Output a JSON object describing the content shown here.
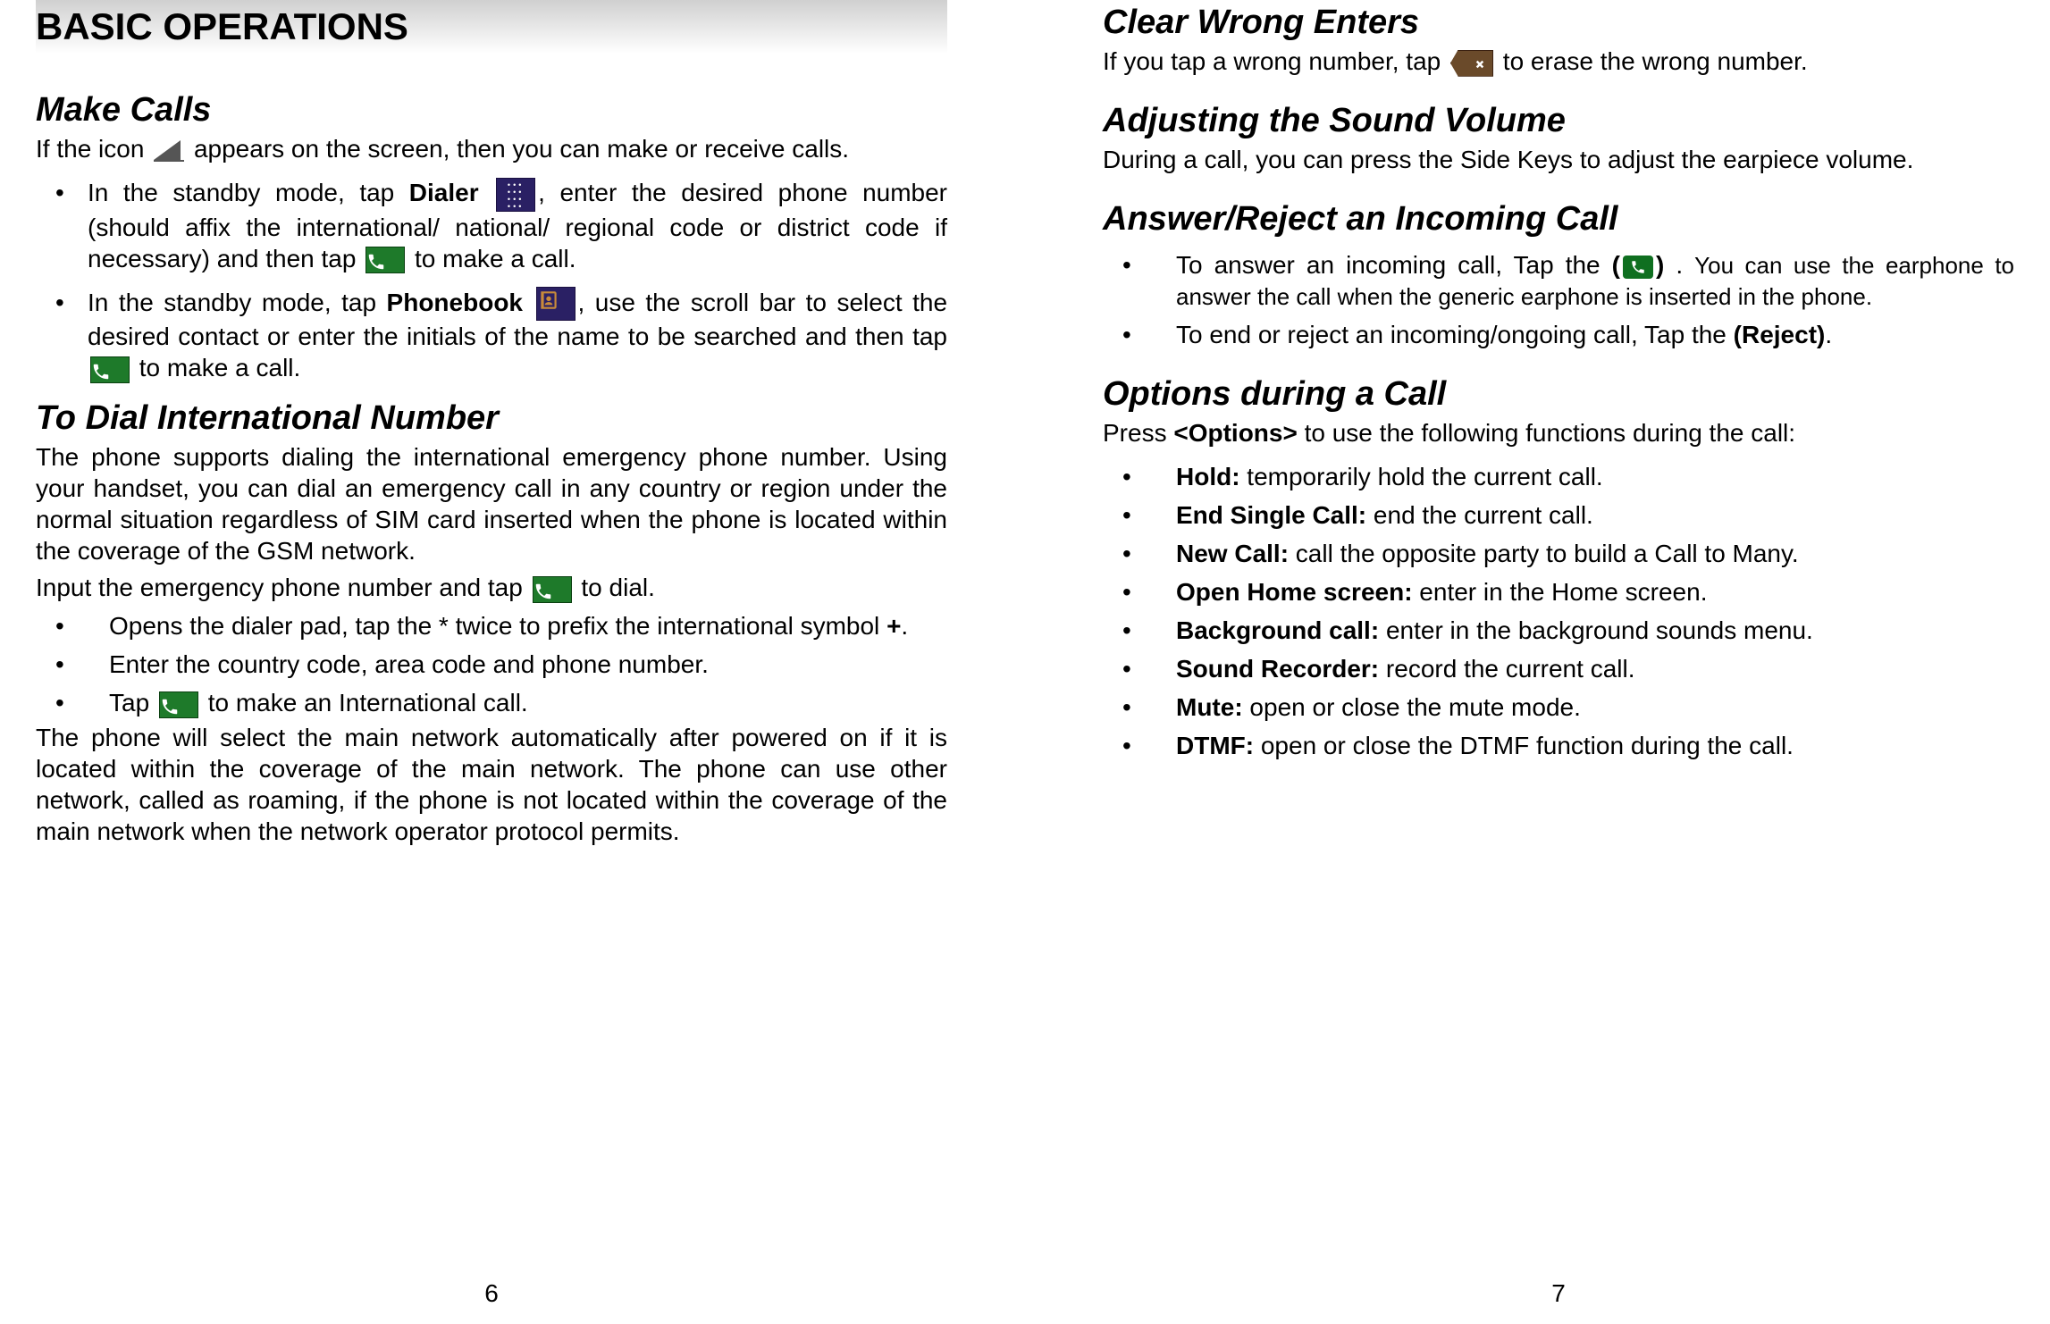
{
  "left": {
    "chapter_title": "BASIC OPERATIONS",
    "make_calls": {
      "title": "Make Calls",
      "intro_a": "If the icon ",
      "intro_b": " appears on the screen, then you can make or receive calls.",
      "b1_a": "In the standby mode, tap ",
      "b1_dialer": "Dialer",
      "b1_b": ", enter the desired phone number (should affix the international/ national/ regional code or district code if necessary) and then tap ",
      "b1_c": " to make a call.",
      "b2_a": "In the standby mode, tap ",
      "b2_phonebook": "Phonebook",
      "b2_b": ", use the scroll bar to select the desired contact or enter the initials of the name to be searched and then tap ",
      "b2_c": " to make a call."
    },
    "dial_intl": {
      "title": "To Dial International Number",
      "para1": "The phone supports dialing the international emergency phone number. Using your handset, you can dial an emergency call in any country or region under the normal situation regardless of SIM card inserted when the phone is located within the coverage of the GSM network.",
      "para2_a": "Input the emergency phone number and tap ",
      "para2_b": " to dial.",
      "b1_a": "Opens the dialer pad, tap the * twice to prefix the international symbol ",
      "b1_plus": "+",
      "b1_b": ".",
      "b2": "Enter the country code, area code and phone number.",
      "b3_a": "Tap ",
      "b3_b": " to make an International call.",
      "para3": "The phone will select the main network automatically after powered on if it is located within the coverage of the main network. The phone can use other network, called as roaming, if the phone is not located within the coverage of the main network when the network operator protocol permits."
    },
    "page_number": "6"
  },
  "right": {
    "clear_wrong": {
      "title": "Clear Wrong Enters",
      "a": "If you tap a wrong number, tap ",
      "b": " to erase the wrong number."
    },
    "sound": {
      "title": "Adjusting the Sound Volume",
      "p": "During a call, you can press the Side Keys to adjust the earpiece volume."
    },
    "answer": {
      "title": "Answer/Reject an Incoming Call",
      "b1_a": "To answer an incoming call, Tap the ",
      "b1_paren_open": "(",
      "b1_paren_close": ")",
      "b1_b": " . ",
      "b1_c": "You can use the earphone to answer the call when the generic earphone is inserted in the phone.",
      "b2_a": "To end or reject an incoming/ongoing call, Tap the ",
      "b2_reject": "(Reject)",
      "b2_b": "."
    },
    "options": {
      "title": "Options during a Call",
      "intro_a": "Press ",
      "intro_opt": "<Options>",
      "intro_b": " to use the following functions during the call:",
      "items": [
        {
          "label": "Hold:",
          "desc": " temporarily hold the current call."
        },
        {
          "label": "End Single Call:",
          "desc": " end the current call."
        },
        {
          "label": "New Call:",
          "desc": " call the opposite party to build a Call to Many."
        },
        {
          "label": "Open Home screen:",
          "desc": " enter in the Home screen."
        },
        {
          "label": "Background call:",
          "desc": " enter in the background sounds menu."
        },
        {
          "label": "Sound Recorder:",
          "desc": " record the current call."
        },
        {
          "label": "Mute:",
          "desc": " open or close the mute mode."
        },
        {
          "label": "DTMF:",
          "desc": " open or close the DTMF function during the call."
        }
      ]
    },
    "page_number": "7"
  }
}
